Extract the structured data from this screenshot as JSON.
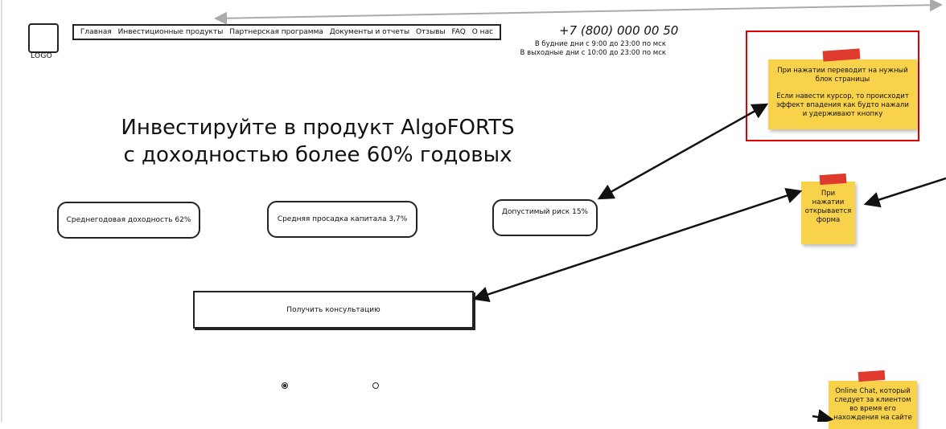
{
  "header": {
    "logo_text": "LOGO",
    "nav": [
      "Главная",
      "Инвестиционные продукты",
      "Партнерская программа",
      "Документы и отчеты",
      "Отзывы",
      "FAQ",
      "О нас"
    ],
    "phone": "+7 (800) 000 00 50",
    "hours": [
      "В будние дни с 9:00 до 23:00 по мск",
      "В выходные дни с 10:00 до 23:00 по мск"
    ]
  },
  "hero": {
    "line1": "Инвестируйте в продукт AlgoFORTS",
    "line2": "с доходностью более 60% годовых"
  },
  "stats": [
    "Среднегодовая доходность 62%",
    "Средняя просадка капитала 3,7%",
    "Допустимый риск 15%"
  ],
  "cta_label": "Получить консультацию",
  "slider": {
    "selected_index": 0,
    "count": 2
  },
  "annotations": {
    "note1_p1": "При нажатии переводит на нужный блок страницы",
    "note1_p2": "Если навести курсор, то происходит эффект впадения как будто нажали и удерживают кнопку",
    "note2": "При нажатии открывается форма",
    "note3": "Online Chat, который следует за клиентом во время его нахождения на сайте"
  },
  "colors": {
    "note": "#f8d24b",
    "tape": "#e03a2e",
    "highlight": "#e00000",
    "connector": "#aaaaaa"
  }
}
